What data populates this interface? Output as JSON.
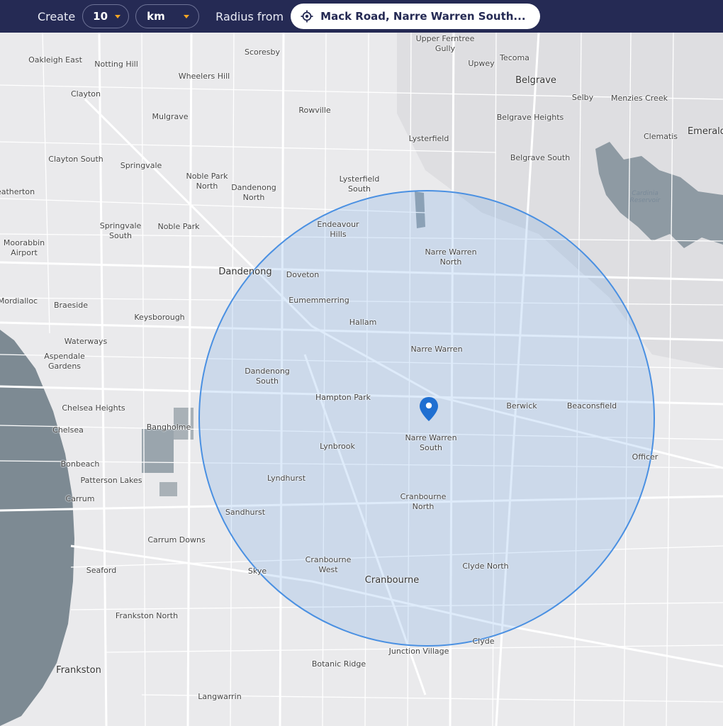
{
  "toolbar": {
    "create_label": "Create",
    "radius_value": "10",
    "unit_value": "km",
    "radius_from_label": "Radius from",
    "address": "Mack Road, Narre Warren South..."
  },
  "map": {
    "marker_label": "Narre Warren South",
    "circle_color": "#4a90e2",
    "places": [
      {
        "name": "Upper Ferntree\nGully"
      },
      {
        "name": "Oakleigh East"
      },
      {
        "name": "Notting Hill"
      },
      {
        "name": "Scoresby"
      },
      {
        "name": "Tecoma"
      },
      {
        "name": "Upwey"
      },
      {
        "name": "Belgrave"
      },
      {
        "name": "Wheelers Hill"
      },
      {
        "name": "Clayton"
      },
      {
        "name": "Selby"
      },
      {
        "name": "Menzies Creek"
      },
      {
        "name": "Rowville"
      },
      {
        "name": "Mulgrave"
      },
      {
        "name": "Belgrave Heights"
      },
      {
        "name": "Lysterfield"
      },
      {
        "name": "Clematis"
      },
      {
        "name": "Emerald"
      },
      {
        "name": "Clayton South"
      },
      {
        "name": "Springvale"
      },
      {
        "name": "Belgrave South"
      },
      {
        "name": "Noble Park\nNorth"
      },
      {
        "name": "Dandenong\nNorth"
      },
      {
        "name": "Lysterfield\nSouth"
      },
      {
        "name": "eatherton"
      },
      {
        "name": "Cardinia\nReservoir"
      },
      {
        "name": "Springvale\nSouth"
      },
      {
        "name": "Noble Park"
      },
      {
        "name": "Endeavour\nHills"
      },
      {
        "name": "Moorabbin\nAirport"
      },
      {
        "name": "Narre Warren\nNorth"
      },
      {
        "name": "Dandenong"
      },
      {
        "name": "Doveton"
      },
      {
        "name": "Mordialloc"
      },
      {
        "name": "Braeside"
      },
      {
        "name": "Eumemmerring"
      },
      {
        "name": "Keysborough"
      },
      {
        "name": "Hallam"
      },
      {
        "name": "Waterways"
      },
      {
        "name": "Narre Warren"
      },
      {
        "name": "Aspendale\nGardens"
      },
      {
        "name": "Dandenong\nSouth"
      },
      {
        "name": "Hampton Park"
      },
      {
        "name": "Berwick"
      },
      {
        "name": "Beaconsfield"
      },
      {
        "name": "Chelsea Heights"
      },
      {
        "name": "Bangholme"
      },
      {
        "name": "Chelsea"
      },
      {
        "name": "Narre Warren\nSouth"
      },
      {
        "name": "Lynbrook"
      },
      {
        "name": "Officer"
      },
      {
        "name": "Bonbeach"
      },
      {
        "name": "Patterson Lakes"
      },
      {
        "name": "Lyndhurst"
      },
      {
        "name": "Carrum"
      },
      {
        "name": "Cranbourne\nNorth"
      },
      {
        "name": "Sandhurst"
      },
      {
        "name": "Carrum Downs"
      },
      {
        "name": "Cranbourne\nWest"
      },
      {
        "name": "Clyde North"
      },
      {
        "name": "Seaford"
      },
      {
        "name": "Skye"
      },
      {
        "name": "Cranbourne"
      },
      {
        "name": "Frankston North"
      },
      {
        "name": "Junction Village"
      },
      {
        "name": "Clyde"
      },
      {
        "name": "Botanic Ridge"
      },
      {
        "name": "Frankston"
      },
      {
        "name": "Langwarrin"
      }
    ]
  }
}
